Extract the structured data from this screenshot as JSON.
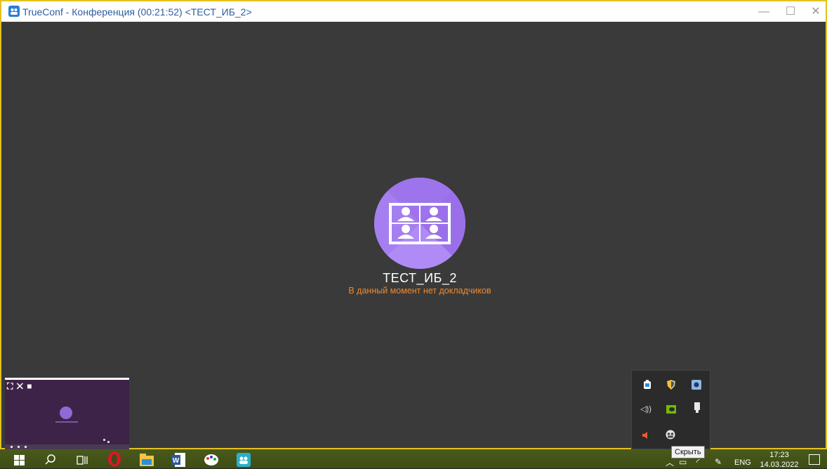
{
  "window": {
    "title": "TrueConf - Конференция (00:21:52) <ТЕСТ_ИБ_2>",
    "minimize_symbol": "—",
    "maximize_symbol": "☐",
    "close_symbol": "✕"
  },
  "conference": {
    "name": "ТЕСТ_ИБ_2",
    "status": "В данный момент нет докладчиков",
    "avatar_icon": "group-conference-icon",
    "avatar_color": "#a37cf0"
  },
  "self_preview": {
    "indicator_icons": [
      "camera-icon",
      "mic-off-icon",
      "video-off-icon"
    ]
  },
  "tray_popup": {
    "tooltip": "Скрыть",
    "icons": [
      "battery-icon",
      "shield-icon",
      "app-icon",
      "speaker-icon",
      "nvidia-icon",
      "usb-icon",
      "volume-muted-icon",
      "trueconf-icon"
    ]
  },
  "taskbar": {
    "apps": [
      "windows-start-icon",
      "search-icon",
      "task-view-icon",
      "opera-icon",
      "file-explorer-icon",
      "word-icon",
      "paint-icon",
      "trueconf-icon"
    ],
    "language": "ENG",
    "time": "17:23",
    "date": "14.03.2022"
  },
  "colors": {
    "accent_border": "#e3c21e",
    "status_orange": "#f08a2c",
    "taskbar": "#3d4d14"
  }
}
